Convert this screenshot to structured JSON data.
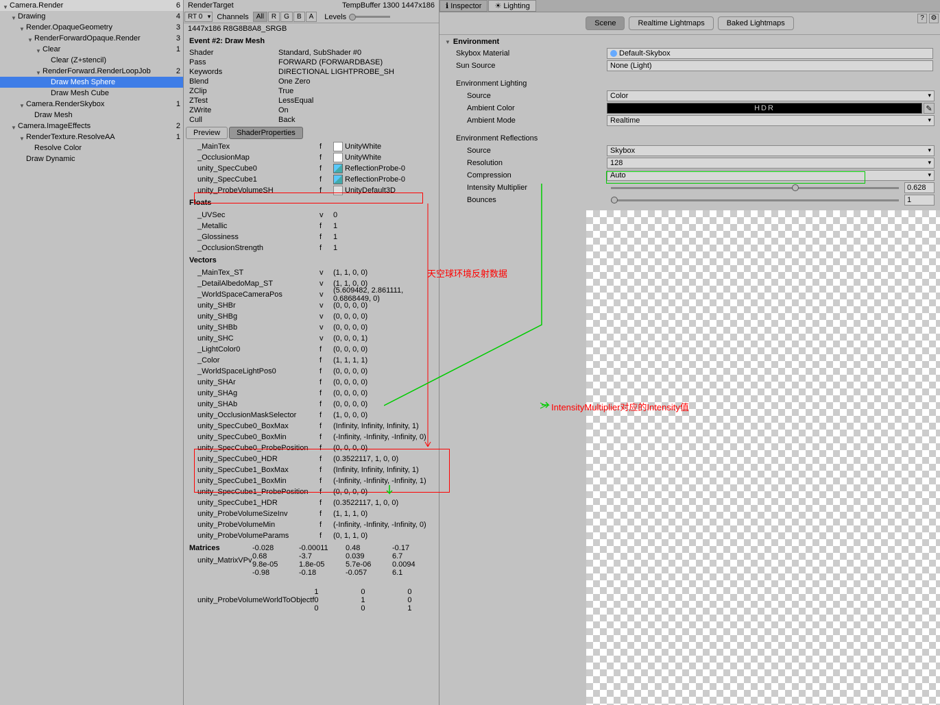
{
  "left_tree": [
    {
      "label": "Camera.Render",
      "indent": 0,
      "count": 6,
      "tri": true
    },
    {
      "label": "Drawing",
      "indent": 1,
      "count": 4,
      "tri": true
    },
    {
      "label": "Render.OpaqueGeometry",
      "indent": 2,
      "count": 3,
      "tri": true
    },
    {
      "label": "RenderForwardOpaque.Render",
      "indent": 3,
      "count": 3,
      "tri": true
    },
    {
      "label": "Clear",
      "indent": 4,
      "count": 1,
      "tri": true
    },
    {
      "label": "Clear (Z+stencil)",
      "indent": 5,
      "count": "",
      "tri": false
    },
    {
      "label": "RenderForward.RenderLoopJob",
      "indent": 4,
      "count": 2,
      "tri": true
    },
    {
      "label": "Draw Mesh Sphere",
      "indent": 5,
      "count": "",
      "tri": false,
      "sel": true
    },
    {
      "label": "Draw Mesh Cube",
      "indent": 5,
      "count": "",
      "tri": false
    },
    {
      "label": "Camera.RenderSkybox",
      "indent": 2,
      "count": 1,
      "tri": true
    },
    {
      "label": "Draw Mesh",
      "indent": 3,
      "count": "",
      "tri": false
    },
    {
      "label": "Camera.ImageEffects",
      "indent": 1,
      "count": 2,
      "tri": true
    },
    {
      "label": "RenderTexture.ResolveAA",
      "indent": 2,
      "count": 1,
      "tri": true
    },
    {
      "label": "Resolve Color",
      "indent": 3,
      "count": "",
      "tri": false
    },
    {
      "label": "Draw Dynamic",
      "indent": 2,
      "count": "",
      "tri": false
    }
  ],
  "mid": {
    "renderTarget": "RenderTarget",
    "tempBuffer": "TempBuffer 1300 1447x186",
    "rt": "RT 0",
    "channels": "Channels",
    "ch_all": "All",
    "ch_r": "R",
    "ch_g": "G",
    "ch_b": "B",
    "ch_a": "A",
    "levels": "Levels",
    "format": "1447x186 R8G8B8A8_SRGB",
    "event": "Event #2: Draw Mesh",
    "info": [
      {
        "k": "Shader",
        "v": "Standard, SubShader #0"
      },
      {
        "k": "Pass",
        "v": "FORWARD (FORWARDBASE)"
      },
      {
        "k": "Keywords",
        "v": "DIRECTIONAL LIGHTPROBE_SH"
      },
      {
        "k": "Blend",
        "v": "One Zero"
      },
      {
        "k": "ZClip",
        "v": "True"
      },
      {
        "k": "ZTest",
        "v": "LessEqual"
      },
      {
        "k": "ZWrite",
        "v": "On"
      },
      {
        "k": "Cull",
        "v": "Back"
      }
    ],
    "tab_preview": "Preview",
    "tab_sp": "ShaderProperties",
    "textures": [
      {
        "n": "_MainTex",
        "t": "f",
        "obj": "UnityWhite",
        "ico": "sw"
      },
      {
        "n": "_OcclusionMap",
        "t": "f",
        "obj": "UnityWhite",
        "ico": "sw"
      },
      {
        "n": "unity_SpecCube0",
        "t": "f",
        "obj": "ReflectionProbe-0",
        "ico": "cu"
      },
      {
        "n": "unity_SpecCube1",
        "t": "f",
        "obj": "ReflectionProbe-0",
        "ico": "cu"
      },
      {
        "n": "unity_ProbeVolumeSH",
        "t": "f",
        "obj": "UnityDefault3D",
        "ico": "3d"
      }
    ],
    "floats_h": "Floats",
    "floats": [
      {
        "n": "_UVSec",
        "t": "v",
        "v": "0"
      },
      {
        "n": "_Metallic",
        "t": "f",
        "v": "1"
      },
      {
        "n": "_Glossiness",
        "t": "f",
        "v": "1"
      },
      {
        "n": "_OcclusionStrength",
        "t": "f",
        "v": "1"
      }
    ],
    "vectors_h": "Vectors",
    "vectors": [
      {
        "n": "_MainTex_ST",
        "t": "v",
        "v": "(1, 1, 0, 0)"
      },
      {
        "n": "_DetailAlbedoMap_ST",
        "t": "v",
        "v": "(1, 1, 0, 0)"
      },
      {
        "n": "_WorldSpaceCameraPos",
        "t": "v",
        "v": "(5.609482, 2.861111, 0.6868449, 0)"
      },
      {
        "n": "unity_SHBr",
        "t": "v",
        "v": "(0, 0, 0, 0)"
      },
      {
        "n": "unity_SHBg",
        "t": "v",
        "v": "(0, 0, 0, 0)"
      },
      {
        "n": "unity_SHBb",
        "t": "v",
        "v": "(0, 0, 0, 0)"
      },
      {
        "n": "unity_SHC",
        "t": "v",
        "v": "(0, 0, 0, 1)"
      },
      {
        "n": "_LightColor0",
        "t": "f",
        "v": "(0, 0, 0, 0)"
      },
      {
        "n": "_Color",
        "t": "f",
        "v": "(1, 1, 1, 1)"
      },
      {
        "n": "_WorldSpaceLightPos0",
        "t": "f",
        "v": "(0, 0, 0, 0)"
      },
      {
        "n": "unity_SHAr",
        "t": "f",
        "v": "(0, 0, 0, 0)"
      },
      {
        "n": "unity_SHAg",
        "t": "f",
        "v": "(0, 0, 0, 0)"
      },
      {
        "n": "unity_SHAb",
        "t": "f",
        "v": "(0, 0, 0, 0)"
      },
      {
        "n": "unity_OcclusionMaskSelector",
        "t": "f",
        "v": "(1, 0, 0, 0)"
      },
      {
        "n": "unity_SpecCube0_BoxMax",
        "t": "f",
        "v": "(Infinity, Infinity, Infinity, 1)"
      },
      {
        "n": "unity_SpecCube0_BoxMin",
        "t": "f",
        "v": "(-Infinity, -Infinity, -Infinity, 0)"
      },
      {
        "n": "unity_SpecCube0_ProbePosition",
        "t": "f",
        "v": "(0, 0, 0, 0)"
      },
      {
        "n": "unity_SpecCube0_HDR",
        "t": "f",
        "v": "(0.3522117, 1, 0, 0)"
      },
      {
        "n": "unity_SpecCube1_BoxMax",
        "t": "f",
        "v": "(Infinity, Infinity, Infinity, 1)"
      },
      {
        "n": "unity_SpecCube1_BoxMin",
        "t": "f",
        "v": "(-Infinity, -Infinity, -Infinity, 1)"
      },
      {
        "n": "unity_SpecCube1_ProbePosition",
        "t": "f",
        "v": "(0, 0, 0, 0)"
      },
      {
        "n": "unity_SpecCube1_HDR",
        "t": "f",
        "v": "(0.3522117, 1, 0, 0)"
      },
      {
        "n": "unity_ProbeVolumeSizeInv",
        "t": "f",
        "v": "(1, 1, 1, 0)"
      },
      {
        "n": "unity_ProbeVolumeMin",
        "t": "f",
        "v": "(-Infinity, -Infinity, -Infinity, 0)"
      },
      {
        "n": "unity_ProbeVolumeParams",
        "t": "f",
        "v": "(0, 1, 1, 0)"
      }
    ],
    "matrices_h": "Matrices",
    "mat1_n": "unity_MatrixVP",
    "mat1_t": "v",
    "mat1": [
      "-0.028",
      "-0.00011",
      "0.48",
      "-0.17",
      "0.68",
      "-3.7",
      "0.039",
      "6.7",
      "9.8e-05",
      "1.8e-05",
      "5.7e-06",
      "0.0094",
      "-0.98",
      "-0.18",
      "-0.057",
      "6.1"
    ],
    "mat2_n": "unity_ProbeVolumeWorldToObject",
    "mat2_t": "f",
    "mat2": [
      "1",
      "0",
      "0",
      "0",
      "0",
      "1",
      "0",
      "0",
      "0",
      "0",
      "1",
      "0"
    ]
  },
  "right": {
    "tab_inspector": "Inspector",
    "tab_lighting": "Lighting",
    "mode_scene": "Scene",
    "mode_rl": "Realtime Lightmaps",
    "mode_bl": "Baked Lightmaps",
    "env": "Environment",
    "skybox_l": "Skybox Material",
    "skybox_v": "Default-Skybox",
    "sun_l": "Sun Source",
    "sun_v": "None (Light)",
    "envlight": "Environment Lighting",
    "src_l": "Source",
    "src_v": "Color",
    "amb_l": "Ambient Color",
    "amb_hdr": "HDR",
    "ambmode_l": "Ambient Mode",
    "ambmode_v": "Realtime",
    "envref": "Environment Reflections",
    "rsrc_l": "Source",
    "rsrc_v": "Skybox",
    "res_l": "Resolution",
    "res_v": "128",
    "comp_l": "Compression",
    "comp_v": "Auto",
    "int_l": "Intensity Multiplier",
    "int_v": "0.628",
    "bnc_l": "Bounces",
    "bnc_v": "1"
  },
  "ann1": "天空球环境反射数据",
  "ann2": "IntensityMultiplier对应的Intensity值"
}
